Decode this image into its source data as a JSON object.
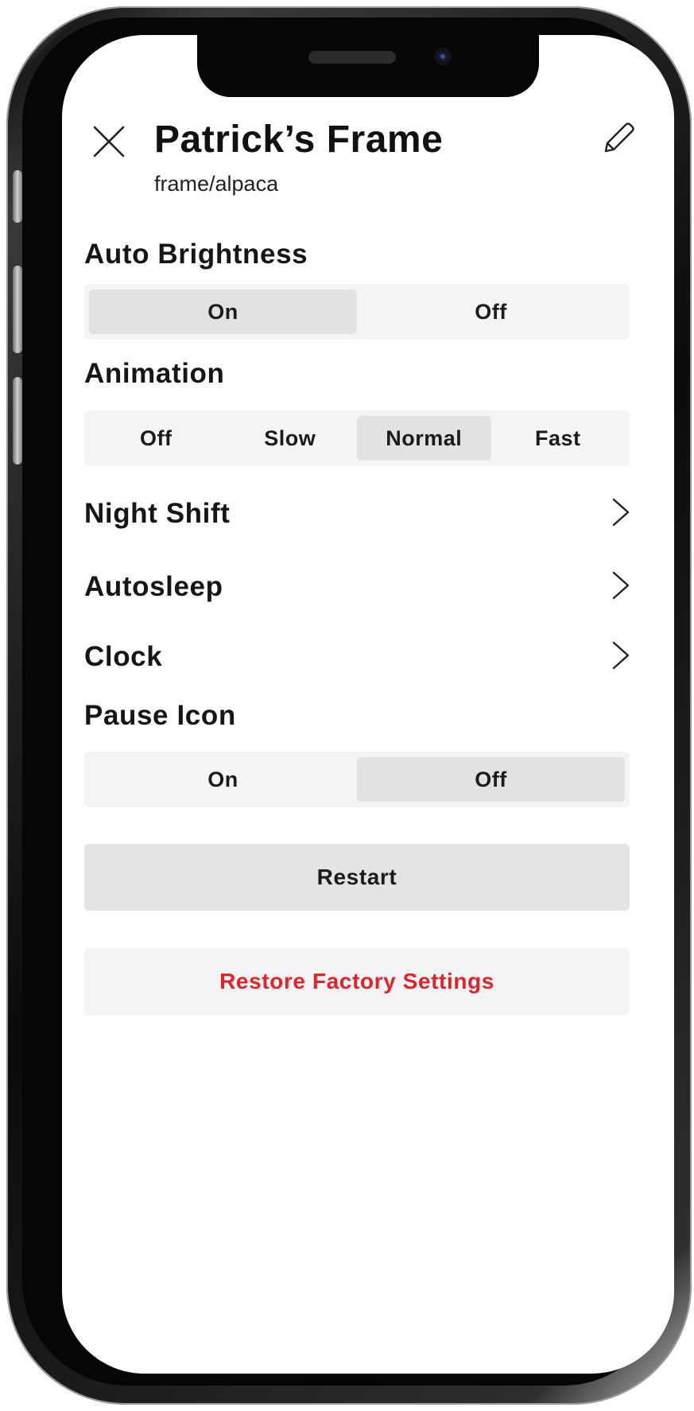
{
  "header": {
    "title": "Patrick’s Frame",
    "subtitle": "frame/alpaca",
    "close_icon": "close-icon",
    "edit_icon": "pencil-icon"
  },
  "auto_brightness": {
    "label": "Auto Brightness",
    "options": [
      "On",
      "Off"
    ],
    "selected": "On"
  },
  "animation": {
    "label": "Animation",
    "options": [
      "Off",
      "Slow",
      "Normal",
      "Fast"
    ],
    "selected": "Normal"
  },
  "nav_rows": [
    {
      "label": "Night Shift"
    },
    {
      "label": "Autosleep"
    },
    {
      "label": "Clock"
    }
  ],
  "pause_icon": {
    "label": "Pause Icon",
    "options": [
      "On",
      "Off"
    ],
    "selected": "Off"
  },
  "actions": {
    "restart_label": "Restart",
    "restore_label": "Restore Factory Settings",
    "restore_color": "#e3222a"
  },
  "colors": {
    "selected_segment": "#e2e2e2",
    "segment_background": "#f4f4f4",
    "text": "#161616"
  }
}
